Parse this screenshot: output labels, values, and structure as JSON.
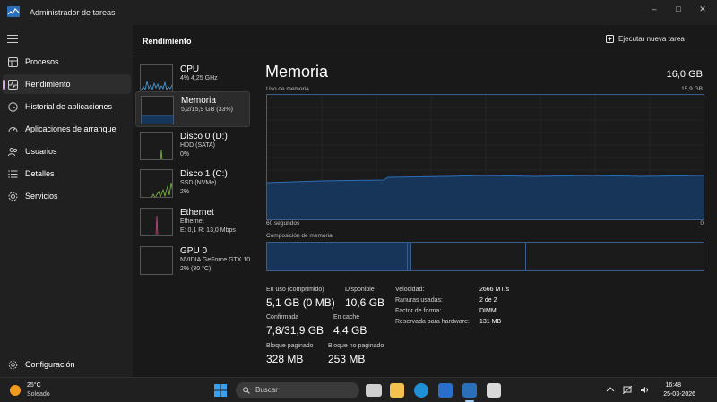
{
  "window": {
    "title": "Administrador de tareas"
  },
  "sidebar": {
    "items": [
      {
        "label": "Procesos",
        "icon": "grid-icon"
      },
      {
        "label": "Rendimiento",
        "icon": "pulse-icon",
        "active": true
      },
      {
        "label": "Historial de aplicaciones",
        "icon": "history-icon"
      },
      {
        "label": "Aplicaciones de arranque",
        "icon": "speedometer-icon"
      },
      {
        "label": "Usuarios",
        "icon": "users-icon"
      },
      {
        "label": "Detalles",
        "icon": "list-icon"
      },
      {
        "label": "Servicios",
        "icon": "puzzle-icon"
      }
    ],
    "settings_label": "Configuración"
  },
  "header": {
    "title": "Rendimiento",
    "new_task_label": "Ejecutar nueva tarea"
  },
  "perf_list": [
    {
      "name": "CPU",
      "line1": "4% 4,25 GHz",
      "line2": "",
      "color": "#4aa3df"
    },
    {
      "name": "Memoria",
      "line1": "5,2/15,9 GB (33%)",
      "line2": "",
      "color": "#2f6cb8"
    },
    {
      "name": "Disco 0 (D:)",
      "line1": "HDD (SATA)",
      "line2": "0%",
      "color": "#7fbf3f"
    },
    {
      "name": "Disco 1 (C:)",
      "line1": "SSD (NVMe)",
      "line2": "2%",
      "color": "#7fbf3f"
    },
    {
      "name": "Ethernet",
      "line1": "Ethernet",
      "line2": "E: 0,1 R: 13,0 Mbps",
      "color": "#c24a80"
    },
    {
      "name": "GPU 0",
      "line1": "NVIDIA GeForce GTX 10",
      "line2": "2% (30 °C)",
      "color": "#4aa3df"
    }
  ],
  "detail": {
    "title": "Memoria",
    "total": "16,0 GB",
    "usage_label": "Uso de memoria",
    "usage_max": "15,9 GB",
    "time_left": "60 segundos",
    "time_right": "0",
    "composition_label": "Composición de memoria",
    "stats": {
      "in_use_label": "En uso (comprimido)",
      "in_use_value": "5,1 GB (0 MB)",
      "available_label": "Disponible",
      "available_value": "10,6 GB",
      "committed_label": "Confirmada",
      "committed_value": "7,8/31,9 GB",
      "cached_label": "En caché",
      "cached_value": "4,4 GB",
      "paged_label": "Bloque paginado",
      "paged_value": "328 MB",
      "nonpaged_label": "Bloque no paginado",
      "nonpaged_value": "253 MB"
    },
    "props": [
      {
        "key": "Velocidad:",
        "value": "2666 MT/s"
      },
      {
        "key": "Ranuras usadas:",
        "value": "2 de 2"
      },
      {
        "key": "Factor de forma:",
        "value": "DIMM"
      },
      {
        "key": "Reservada para hardware:",
        "value": "131 MB"
      }
    ]
  },
  "taskbar": {
    "temperature": "25°C",
    "condition": "Soleado",
    "search_placeholder": "Buscar",
    "time": "16:48",
    "date": "25-03-2026"
  },
  "colors": {
    "accent": "#2f6cb8",
    "graph_border": "#3a5f8a",
    "graph_fill": "#163559"
  }
}
